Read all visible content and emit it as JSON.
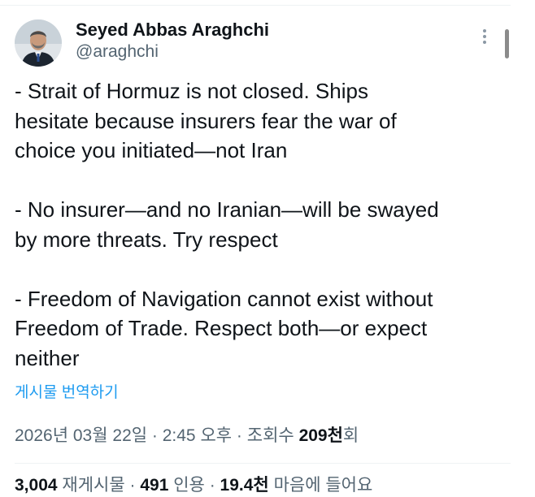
{
  "author": {
    "display_name": "Seyed Abbas Araghchi",
    "handle": "@araghchi",
    "avatar_icon": "profile-photo"
  },
  "menu": {
    "icon": "more-vertical-icon"
  },
  "tweet": {
    "paragraphs": [
      "- Strait of Hormuz is not closed. Ships\nhesitate because insurers fear the war of\nchoice you initiated—not Iran",
      "- No insurer—and no Iranian—will be swayed\nby more threats. Try respect",
      "- Freedom of Navigation cannot exist without\nFreedom of Trade. Respect both—or expect\nneither"
    ],
    "translate_label": "게시물 번역하기"
  },
  "meta": {
    "date": "2026년 03월 22일",
    "separator": " · ",
    "time": "2:45 오후",
    "views_label": "조회수 ",
    "views_count": "209천",
    "views_suffix": "회"
  },
  "stats": {
    "retweets_count": "3,004",
    "retweets_label": " 재게시물 · ",
    "quotes_count": "491",
    "quotes_label": " 인용 · ",
    "likes_count": "19.4천",
    "likes_label": " 마음에 들어요"
  },
  "colors": {
    "text_primary": "#0f1419",
    "text_secondary": "#536471",
    "link": "#1d9bf0"
  }
}
